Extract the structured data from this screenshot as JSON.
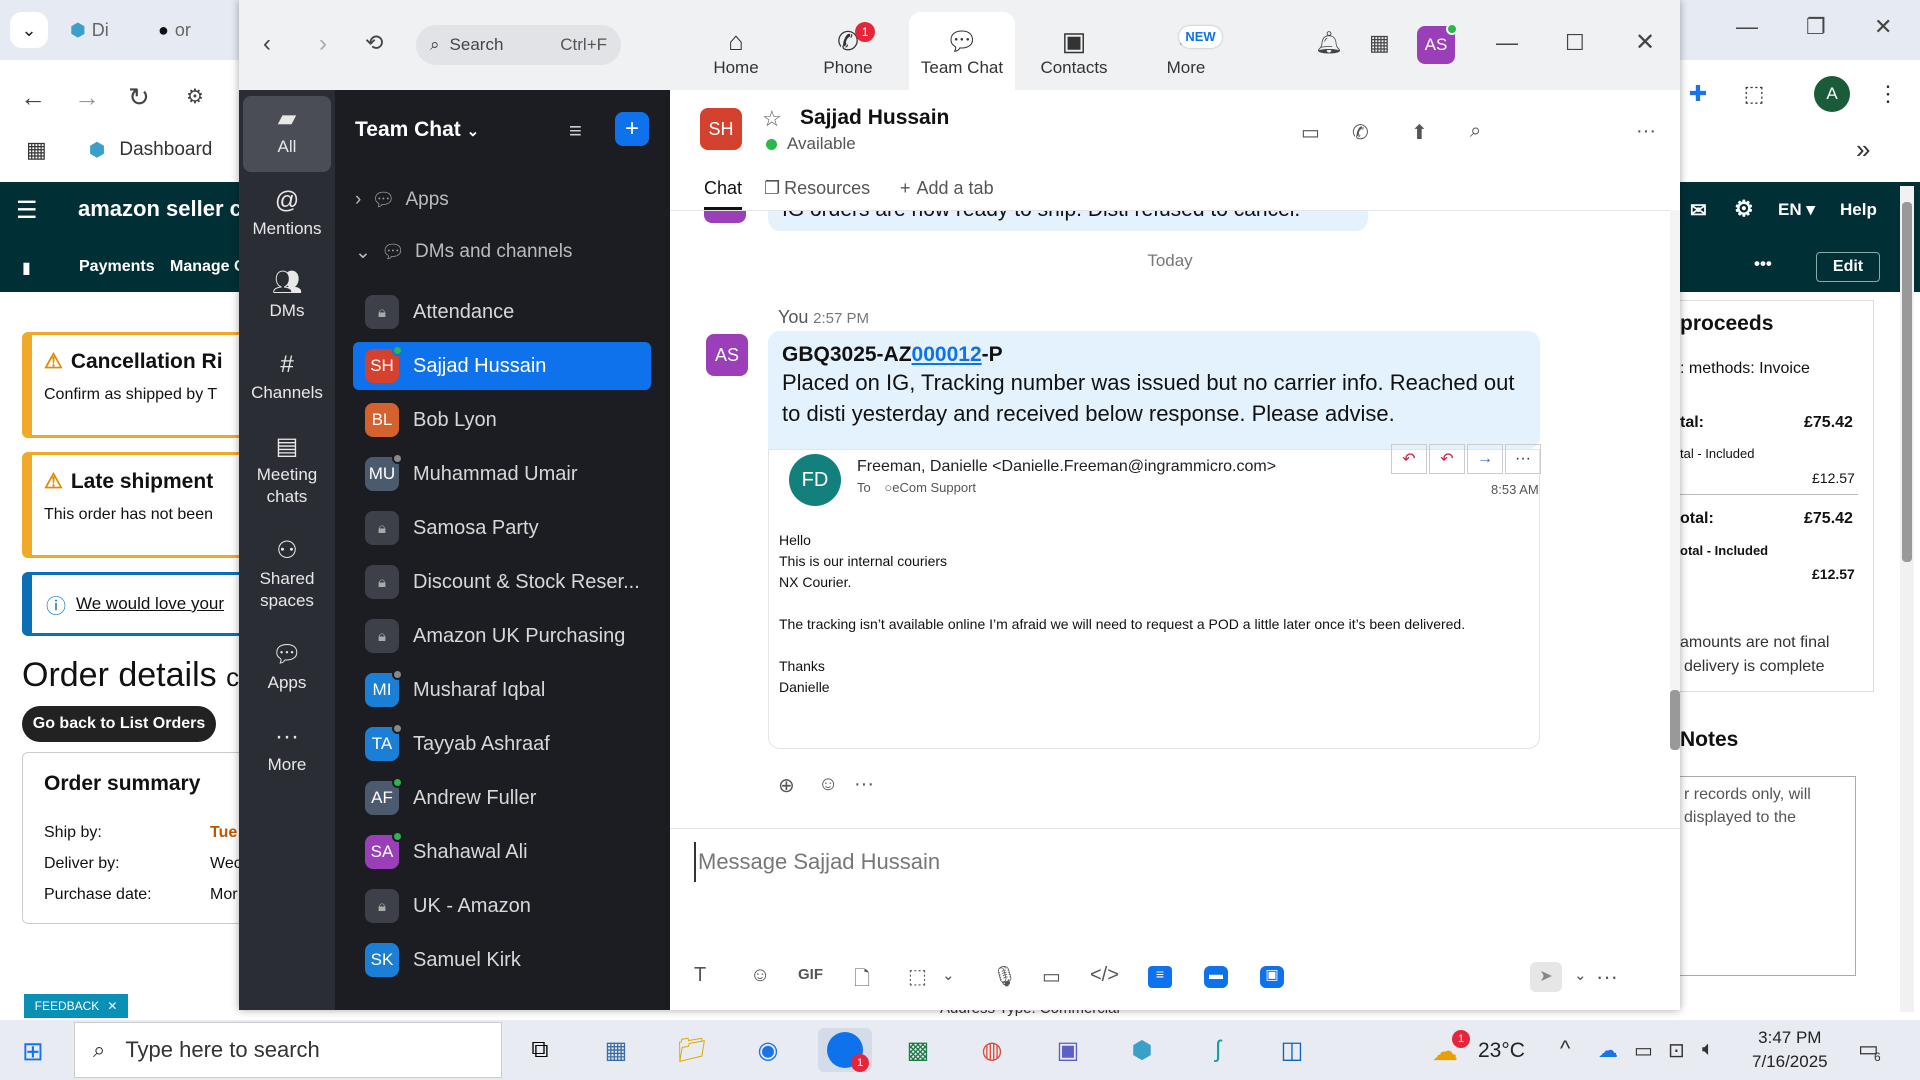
{
  "browser": {
    "tabs": [
      {
        "label": "Di"
      },
      {
        "label": "or"
      }
    ],
    "bookmark_dashboard": "Dashboard",
    "profile_initial": "A"
  },
  "amazon": {
    "logo": "amazon seller centr",
    "nav": [
      "Payments",
      "Manage C"
    ],
    "right": {
      "lang": "EN",
      "help": "Help",
      "edit": "Edit"
    },
    "alert1": {
      "title": "Cancellation Ri",
      "body": "Confirm as shipped by T"
    },
    "alert2": {
      "title": "Late shipment",
      "body": "This order has not been"
    },
    "info": "We would love your",
    "order_details": "Order details",
    "order_details_suffix": "c",
    "back_btn": "Go back to List Orders",
    "summary_title": "Order summary",
    "summary_rows": [
      {
        "label": "Ship by:",
        "value": "Tue"
      },
      {
        "label": "Deliver by:",
        "value": "Wec"
      },
      {
        "label": "Purchase date:",
        "value": "Mor"
      }
    ],
    "feedback": "FEEDBACK",
    "right_panel": {
      "proceeds": "proceeds",
      "methods": ": methods: Invoice",
      "row1_label": "tal:",
      "row1_val": "£75.42",
      "row1_sub": "tal - Included",
      "row1_sub_val": "£12.57",
      "row2_label": "otal:",
      "row2_val": "£75.42",
      "row2_sub": "otal - Included",
      "row2_sub_val": "£12.57",
      "note1": "amounts are not final",
      "note2": "delivery is complete",
      "notes_title": "Notes",
      "notes1": "r records only, will",
      "notes2": "displayed to the"
    },
    "address": "Address Type:  Commercial"
  },
  "zoom": {
    "search_placeholder": "Search",
    "search_shortcut": "Ctrl+F",
    "tabs": [
      {
        "label": "Home",
        "icon": "home-icon"
      },
      {
        "label": "Phone",
        "icon": "phone-icon",
        "badge": "1"
      },
      {
        "label": "Team Chat",
        "icon": "chat-icon"
      },
      {
        "label": "Contacts",
        "icon": "contacts-icon"
      },
      {
        "label": "More",
        "icon": "more-icon",
        "badge": "NEW"
      }
    ],
    "avatar": "AS",
    "rail": [
      {
        "label": "All"
      },
      {
        "label": "Mentions"
      },
      {
        "label": "DMs"
      },
      {
        "label": "Channels"
      },
      {
        "label": "Meeting chats"
      },
      {
        "label": "Shared spaces"
      },
      {
        "label": "Apps"
      },
      {
        "label": "More"
      }
    ],
    "list_title": "Team Chat",
    "sections": {
      "apps": "Apps",
      "dms": "DMs and channels"
    },
    "items": [
      {
        "name": "Attendance",
        "type": "lock"
      },
      {
        "name": "Sajjad Hussain",
        "type": "av",
        "initials": "SH",
        "color": "#d4412e",
        "status": "green"
      },
      {
        "name": "Bob Lyon",
        "type": "av",
        "initials": "BL",
        "color": "#d4612e",
        "status": ""
      },
      {
        "name": "Muhammad Umair",
        "type": "av",
        "initials": "MU",
        "color": "#4c5a6e",
        "status": "grey"
      },
      {
        "name": "Samosa Party",
        "type": "lock"
      },
      {
        "name": "Discount & Stock Reser...",
        "type": "lock"
      },
      {
        "name": "Amazon UK Purchasing",
        "type": "lock"
      },
      {
        "name": "Musharaf Iqbal",
        "type": "av",
        "initials": "MI",
        "color": "#1c7fd6",
        "status": "grey"
      },
      {
        "name": "Tayyab Ashraaf",
        "type": "av",
        "initials": "TA",
        "color": "#1c7fd6",
        "status": "grey"
      },
      {
        "name": "Andrew Fuller",
        "type": "av",
        "initials": "AF",
        "color": "#4c5a6e",
        "status": "green"
      },
      {
        "name": "Shahawal Ali",
        "type": "av",
        "initials": "SA",
        "color": "#9a3fb8",
        "status": "green"
      },
      {
        "name": "UK - Amazon",
        "type": "lock"
      },
      {
        "name": "Samuel Kirk",
        "type": "av",
        "initials": "SK",
        "color": "#1c7fd6",
        "status": ""
      }
    ],
    "chat": {
      "contact_initials": "SH",
      "contact_name": "Sajjad Hussain",
      "status": "Available",
      "tabs": [
        "Chat",
        "Resources",
        "Add a tab"
      ],
      "prev_msg": "IG orders are now ready to ship. Disti refused to cancel.",
      "day": "Today",
      "sender": "You",
      "time": "2:57 PM",
      "sender_initials": "AS",
      "title_pre": "GBQ3025-AZ",
      "title_link": "000012",
      "title_post": "-P",
      "body": "Placed on IG, Tracking number was issued but no carrier info. Reached out to disti yesterday and received below response. Please advise.",
      "email": {
        "initials": "FD",
        "from": "Freeman, Danielle <Danielle.Freeman@ingrammicro.com>",
        "to_label": "To",
        "to": "eCom Support",
        "time": "8:53 AM",
        "lines": [
          "Hello",
          "This is our internal couriers",
          "NX Courier.",
          "",
          "The tracking isn’t available online I’m afraid we will need to request a POD a little later once it’s been delivered.",
          "",
          "Thanks",
          "Danielle"
        ]
      },
      "composer_placeholder": "Message Sajjad Hussain"
    }
  },
  "taskbar": {
    "search": "Type here to search",
    "weather": "23°C",
    "weather_badge": "1",
    "time": "3:47 PM",
    "date": "7/16/2025",
    "notif": "6",
    "zoom_badge": "1"
  }
}
